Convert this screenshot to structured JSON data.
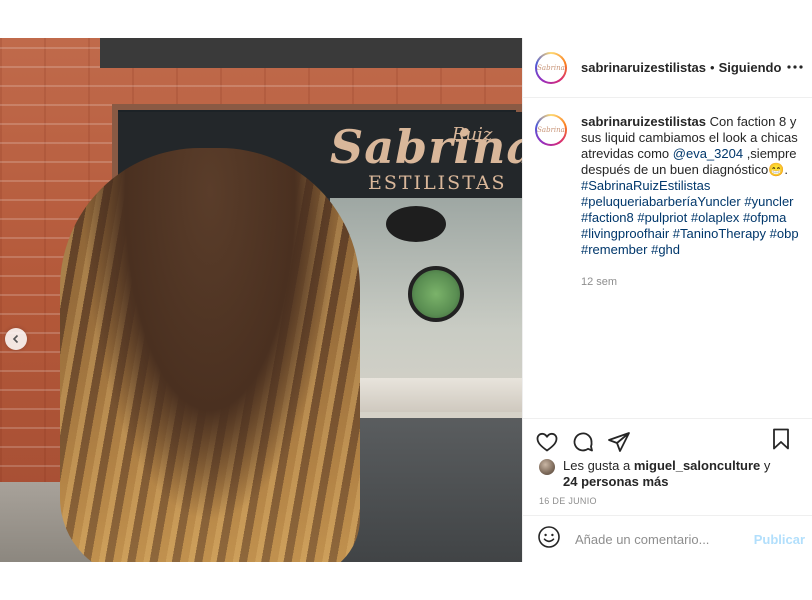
{
  "colors": {
    "accent_link": "#00376b",
    "publish_disabled": "#b2dffc",
    "muted_text": "#8e8e8e",
    "text": "#262626"
  },
  "photo": {
    "sign_brand": "Sabrina",
    "sign_brand_small": "Ruiz",
    "sign_subtitle": "ESTILISTAS",
    "carousel": {
      "slides": 4,
      "active_index": 3
    },
    "prev_icon": "chevron-left-icon"
  },
  "header": {
    "username": "sabrinaruizestilistas",
    "separator": "•",
    "follow_status": "Siguiendo",
    "more_icon": "more-horizontal-icon"
  },
  "caption": {
    "username": "sabrinaruizestilistas",
    "text": "Con faction 8 y sus liquid cambiamos el look a chicas atrevidas como ",
    "mention": "@eva_3204",
    "text_after_mention": " ,siempre después de un buen diagnóstico",
    "emoji": "😁",
    "text_end": ".",
    "hashtags": [
      "#SabrinaRuizEstilistas",
      "#peluqueriabarberíaYuncler",
      "#yuncler",
      "#faction8",
      "#pulpriot",
      "#olaplex",
      "#ofpma",
      "#livingproofhair",
      "#TaninoTherapy",
      "#obp",
      "#remember",
      "#ghd"
    ],
    "time_ago": "12 sem"
  },
  "actions": {
    "like_icon": "heart-icon",
    "comment_icon": "comment-icon",
    "share_icon": "send-icon",
    "save_icon": "bookmark-icon"
  },
  "likes": {
    "prefix": "Les gusta a ",
    "user": "miguel_salonculture",
    "connector": " y",
    "others": "24 personas más"
  },
  "date": "16 DE JUNIO",
  "comment": {
    "emoji_icon": "smiley-icon",
    "placeholder": "Añade un comentario...",
    "publish_label": "Publicar"
  }
}
